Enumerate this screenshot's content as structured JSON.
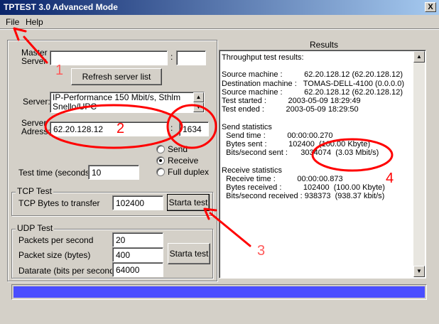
{
  "window": {
    "title": "TPTEST 3.0 Advanced Mode",
    "close_label": "X"
  },
  "menu": {
    "items": [
      "File",
      "Help"
    ]
  },
  "master": {
    "label_line1": "Master",
    "label_line2": "Server",
    "host": "",
    "port": ""
  },
  "refresh_label": "Refresh server list",
  "server": {
    "label": "Server:",
    "selected": "IP-Performance 150 Mbit/s, Sthlm",
    "next": "Snello/UPC"
  },
  "server_address": {
    "label_line1": "Server",
    "label_line2": "Adress:",
    "address": "62.20.128.12",
    "port": "1634"
  },
  "mode": {
    "options": [
      "Send",
      "Receive",
      "Full duplex"
    ],
    "selected": "Receive"
  },
  "test_time": {
    "label": "Test time (seconds)",
    "value": "10"
  },
  "tcp": {
    "group": "TCP Test",
    "bytes_label": "TCP Bytes to transfer",
    "bytes_value": "102400",
    "start_label": "Starta test"
  },
  "udp": {
    "group": "UDP Test",
    "pps_label": "Packets per second",
    "pps_value": "20",
    "size_label": "Packet size (bytes)",
    "size_value": "400",
    "rate_label": "Datarate (bits per second)",
    "rate_value": "64000",
    "start_label": "Starta test"
  },
  "results": {
    "title": "Results",
    "lines": [
      "Throughput test results:",
      "",
      "Source machine :          62.20.128.12 (62.20.128.12)",
      "Destination machine :   TOMAS-DELL-4100 (0.0.0.0)",
      "Source machine :          62.20.128.12 (62.20.128.12)",
      "Test started :          2003-05-09 18:29:49",
      "Test ended :          2003-05-09 18:29:50",
      "",
      "Send statistics",
      "  Send time :          00:00:00.270",
      "  Bytes sent :          102400  (100.00 Kbyte)",
      "  Bits/second sent :      3034074  (3.03 Mbit/s)",
      "",
      "Receive statistics",
      "  Receive time :          00:00:00.873",
      "  Bytes received :          102400  (100.00 Kbyte)",
      "  Bits/second received : 938373  (938.37 kbit/s)"
    ]
  },
  "progress": {
    "fraction": 1.0,
    "color": "#4a4eff"
  },
  "annotations": {
    "numbers": [
      "1",
      "2",
      "3",
      "4"
    ],
    "color": "#ff0000"
  }
}
